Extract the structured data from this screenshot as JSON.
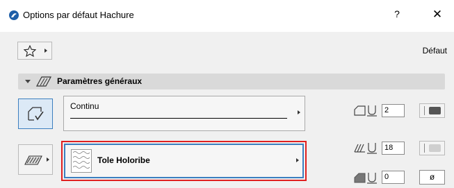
{
  "window": {
    "title": "Options par défaut Hachure",
    "help_label": "?",
    "close_label": "✕"
  },
  "toolbar": {
    "favorites_icon": "star-icon",
    "default_label": "Défaut"
  },
  "section": {
    "label": "Paramètres généraux"
  },
  "line_type": {
    "label": "Continu"
  },
  "contour_pen": {
    "value": "2",
    "swatch_color": "#555555"
  },
  "fill": {
    "label": "Tole Holoribe"
  },
  "fill_pen": {
    "value": "18",
    "swatch_color": "#cfcfcf"
  },
  "background_pen": {
    "value": "0",
    "symbol": "ø"
  },
  "colors": {
    "accent": "#3c7fbf",
    "highlight": "#e02020"
  }
}
